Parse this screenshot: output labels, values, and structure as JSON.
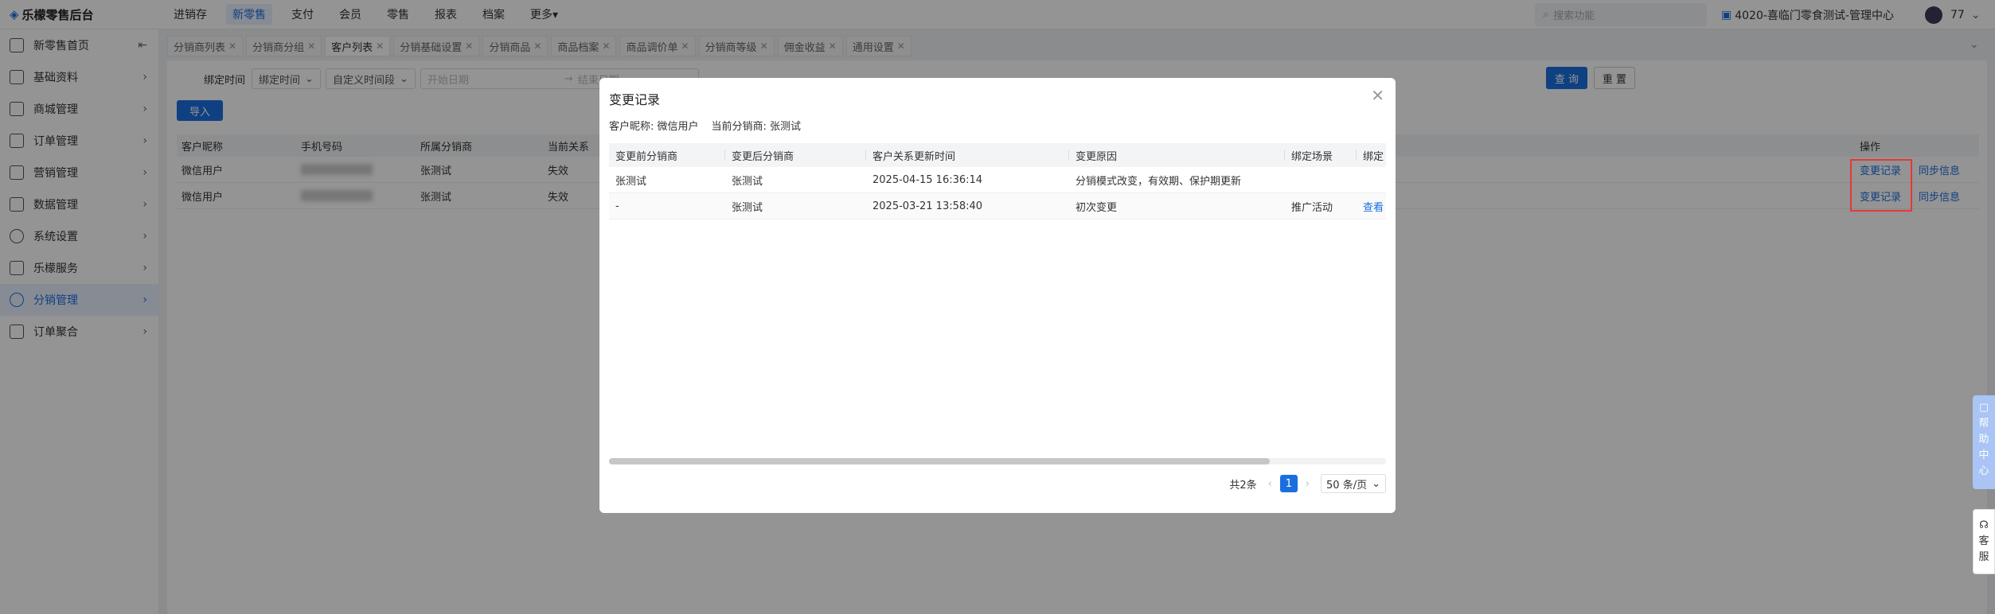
{
  "app": {
    "logo": "乐檬零售后台"
  },
  "topnav": [
    "进销存",
    "新零售",
    "支付",
    "会员",
    "零售",
    "报表",
    "档案",
    "更多▾"
  ],
  "search": {
    "placeholder": "搜索功能"
  },
  "store": "4020-喜临门零食测试-管理中心",
  "user": "77",
  "sidebar": [
    {
      "label": "新零售首页",
      "icon": "home-icon",
      "chev": "⇤"
    },
    {
      "label": "基础资料",
      "icon": "grid-icon",
      "chev": "›"
    },
    {
      "label": "商城管理",
      "icon": "store-icon",
      "chev": "›"
    },
    {
      "label": "订单管理",
      "icon": "order-icon",
      "chev": "›"
    },
    {
      "label": "营销管理",
      "icon": "marketing-icon",
      "chev": "›"
    },
    {
      "label": "数据管理",
      "icon": "chart-icon",
      "chev": "›"
    },
    {
      "label": "系统设置",
      "icon": "settings-icon",
      "chev": "›"
    },
    {
      "label": "乐檬服务",
      "icon": "service-icon",
      "chev": "›"
    },
    {
      "label": "分销管理",
      "icon": "distribution-icon",
      "chev": "›"
    },
    {
      "label": "订单聚合",
      "icon": "aggregate-icon",
      "chev": "›"
    }
  ],
  "tabs": [
    "分销商列表",
    "分销商分组",
    "客户列表",
    "分销基础设置",
    "分销商品",
    "商品档案",
    "商品调价单",
    "分销商等级",
    "佣金收益",
    "通用设置"
  ],
  "filter": {
    "label": "绑定时间",
    "bind_time": "绑定时间",
    "custom": "自定义时间段",
    "start": "开始日期",
    "end": "结束日期",
    "query": "查 询",
    "reset": "重 置",
    "import": "导入"
  },
  "table": {
    "headers": [
      "客户昵称",
      "手机号码",
      "所属分销商",
      "当前关系",
      "操作"
    ],
    "rows": [
      {
        "nick": "微信用户",
        "dist": "张测试",
        "rel": "失效",
        "a1": "变更记录",
        "a2": "同步信息"
      },
      {
        "nick": "微信用户",
        "dist": "张测试",
        "rel": "失效",
        "a1": "变更记录",
        "a2": "同步信息"
      }
    ]
  },
  "modal": {
    "title": "变更记录",
    "customer_label": "客户昵称: 微信用户",
    "dist_label": "当前分销商: 张测试",
    "headers": [
      "变更前分销商",
      "变更后分销商",
      "客户关系更新时间",
      "变更原因",
      "绑定场景",
      "绑定"
    ],
    "rows": [
      {
        "before": "张测试",
        "after": "张测试",
        "time": "2025-04-15 16:36:14",
        "reason": "分销模式改变，有效期、保护期更新",
        "scene": "",
        "view": ""
      },
      {
        "before": "-",
        "after": "张测试",
        "time": "2025-03-21 13:58:40",
        "reason": "初次变更",
        "scene": "推广活动",
        "view": "查看"
      }
    ],
    "total": "共2条",
    "page": "1",
    "page_size": "50 条/页"
  },
  "float": {
    "help": [
      "帮",
      "助",
      "中",
      "心"
    ],
    "cs": [
      "客",
      "服"
    ]
  },
  "colors": {
    "accent": "#1a6fe0",
    "highlight": "#e53935"
  }
}
